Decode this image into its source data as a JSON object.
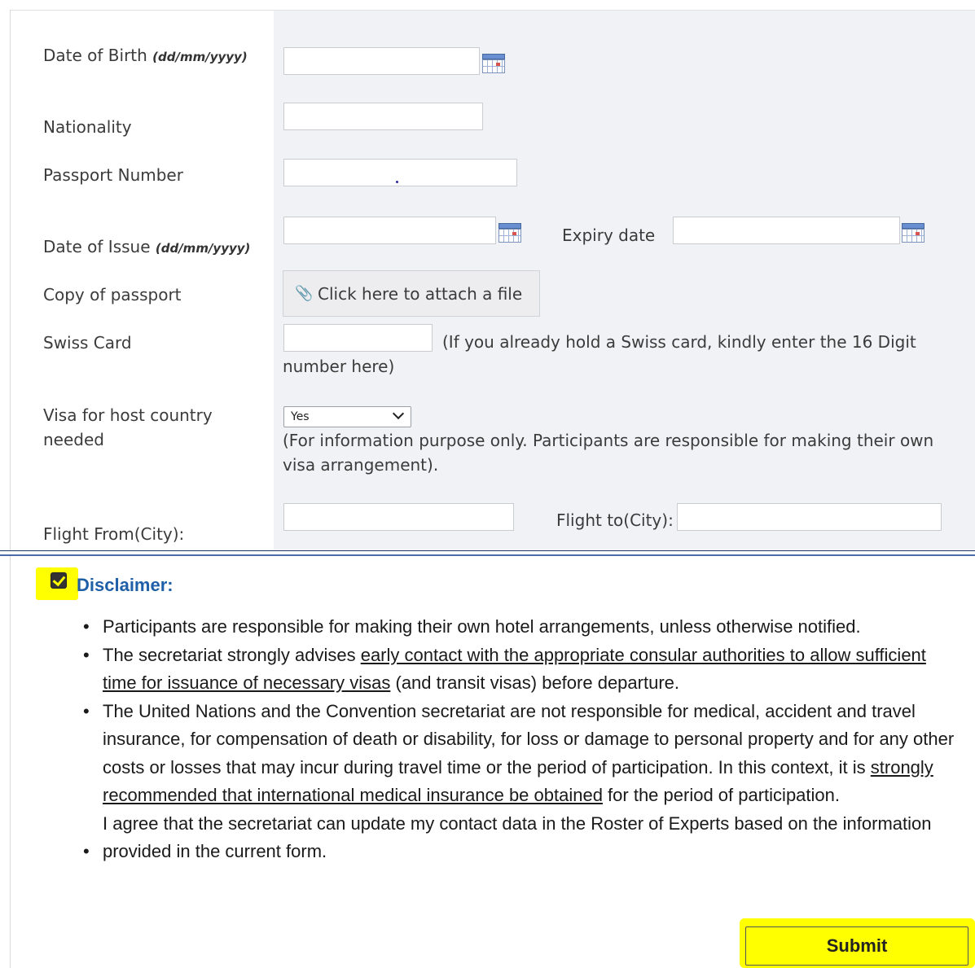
{
  "form": {
    "dob_label": "Date of Birth",
    "dob_hint": "(dd/mm/yyyy)",
    "nationality_label": "Nationality",
    "passport_label": "Passport Number",
    "issue_label": "Date of Issue",
    "issue_hint": "(dd/mm/yyyy)",
    "expiry_label": "Expiry date",
    "copy_label": "Copy of passport",
    "attach_text": "Click here to attach a file",
    "swiss_label": "Swiss Card",
    "swiss_note": "(If you already hold a Swiss card, kindly enter the 16 Digit number here)",
    "visa_label": "Visa for host country needed",
    "visa_selected": "Yes",
    "visa_note": "(For information purpose only. Participants are responsible for making their own visa arrangement).",
    "flight_from_label": "Flight From(City):",
    "flight_to_label": "Flight to(City):"
  },
  "disclaimer": {
    "checked": true,
    "title": "Disclaimer:",
    "b1": "Participants are responsible for making their own hotel arrangements, unless otherwise notified.",
    "b2_pre": "The secretariat strongly advises ",
    "b2_link": "early contact with the appropriate consular authorities to allow sufficient time for issuance of necessary visas",
    "b2_post": " (and transit visas) before departure.",
    "b3_pre": "The United Nations and the Convention secretariat are not responsible for medical, accident and travel insurance, for compensation of death or disability, for loss or damage to personal property and for any other costs or losses that may incur during travel time or the period of participation.  In this context, it is ",
    "b3_link": "strongly recommended that international medical insurance be obtained",
    "b3_post": " for the period of participation.",
    "b4_line1": "I agree that the secretariat can update my contact data in the Roster of Experts based on the information",
    "b4_line2": "provided in the current form."
  },
  "submit_label": "Submit",
  "colors": {
    "highlight": "#ffff00",
    "disclaimer_title": "#1f5fa8",
    "panel_bg": "#f1f2f5"
  },
  "icons": {
    "calendar": "calendar-icon",
    "paperclip": "paperclip-icon",
    "chevron": "chevron-down-icon",
    "checkbox": "checkbox-checked-icon"
  }
}
